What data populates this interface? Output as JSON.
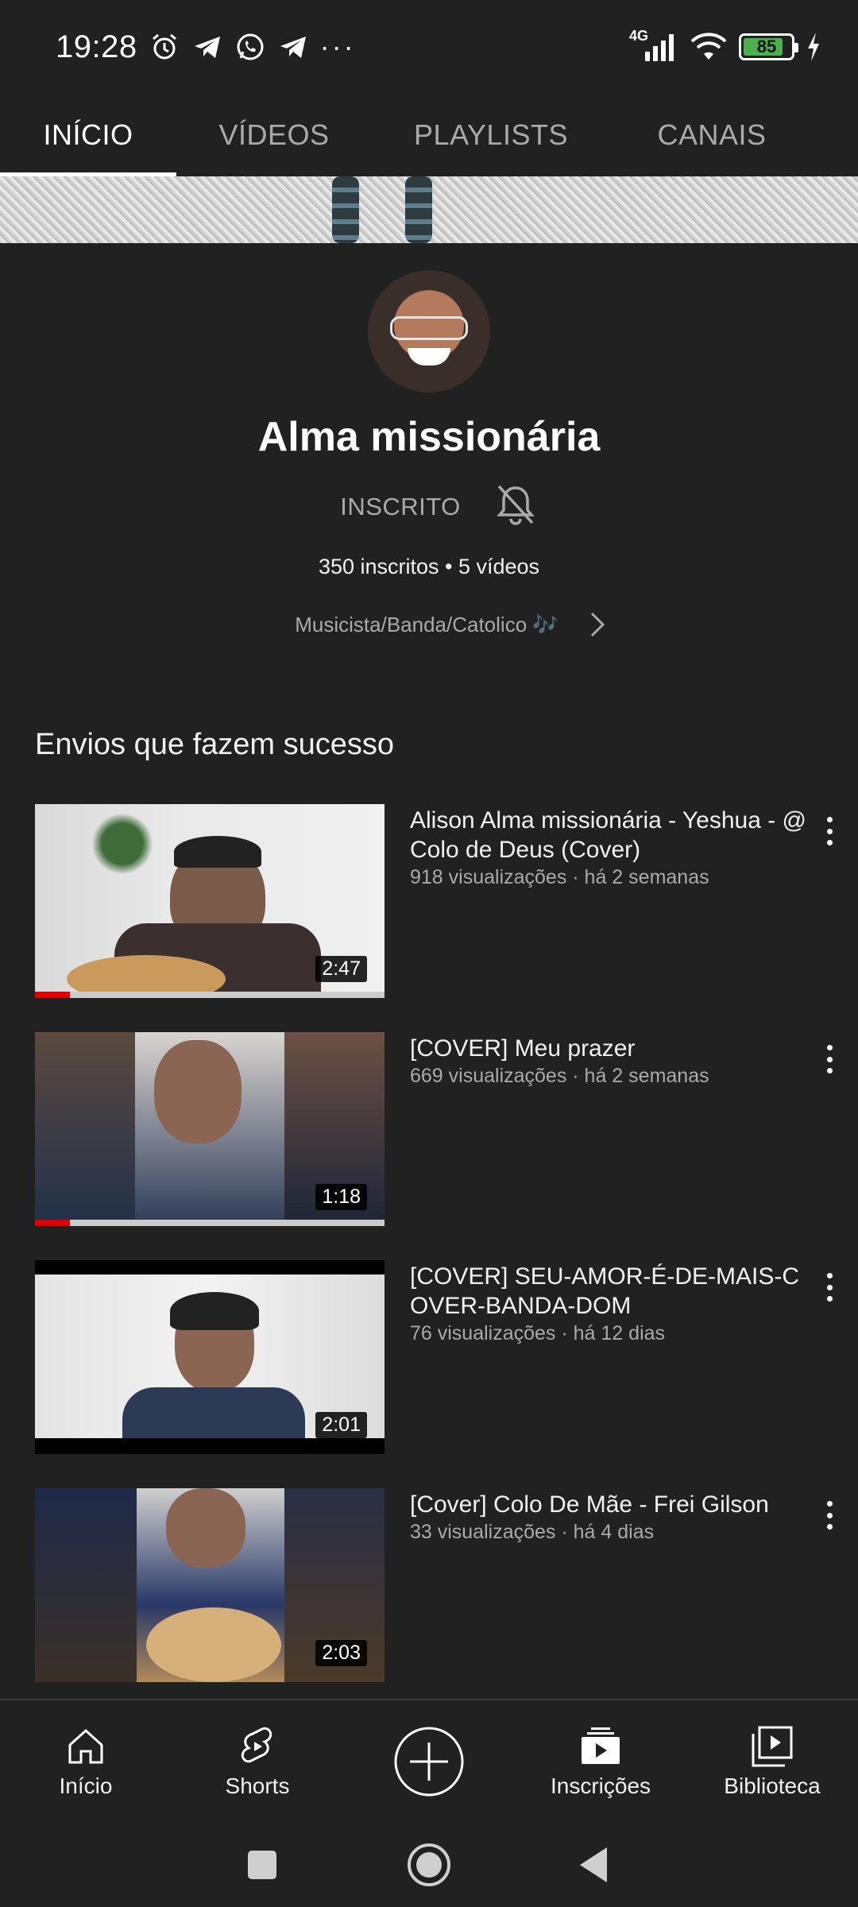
{
  "status_bar": {
    "time": "19:28",
    "icons_left": [
      "alarm-icon",
      "telegram-icon",
      "whatsapp-icon",
      "telegram-icon"
    ],
    "more": "···",
    "network": "4G",
    "battery": "85",
    "battery_level": 0.85,
    "battery_color": "#4caf50"
  },
  "tabs": [
    {
      "label": "INÍCIO",
      "active": true
    },
    {
      "label": "VÍDEOS",
      "active": false
    },
    {
      "label": "PLAYLISTS",
      "active": false
    },
    {
      "label": "CANAIS",
      "active": false
    }
  ],
  "channel": {
    "name": "Alma missionária",
    "subscribe_label": "INSCRITO",
    "stats": "350 inscritos • 5 vídeos",
    "description": "Musicista/Banda/Catolico 🎶"
  },
  "section": {
    "title": "Envios que fazem sucesso"
  },
  "videos": [
    {
      "title": "Alison Alma missionária - Yeshua - @Colo de Deus (Cover)",
      "meta": "918 visualizações · há 2 semanas",
      "duration": "2:47",
      "watched": 0.1
    },
    {
      "title": "[COVER] Meu prazer",
      "meta": "669 visualizações · há 2 semanas",
      "duration": "1:18",
      "watched": 0.1
    },
    {
      "title": "[COVER] SEU-AMOR-É-DE-MAIS-COVER-BANDA-DOM",
      "meta": "76 visualizações · há 12 dias",
      "duration": "2:01",
      "watched": 0
    },
    {
      "title": "[Cover] Colo De Mãe - Frei Gilson",
      "meta": "33 visualizações · há 4 dias",
      "duration": "2:03",
      "watched": 0
    }
  ],
  "bottom_nav": [
    {
      "label": "Início",
      "icon": "home-icon"
    },
    {
      "label": "Shorts",
      "icon": "shorts-icon"
    },
    {
      "label": "",
      "icon": "create-icon"
    },
    {
      "label": "Inscrições",
      "icon": "subscriptions-icon"
    },
    {
      "label": "Biblioteca",
      "icon": "library-icon"
    }
  ],
  "colors": {
    "background": "#212121",
    "progress": "#e00000",
    "secondary_text": "#aaaaaa"
  }
}
